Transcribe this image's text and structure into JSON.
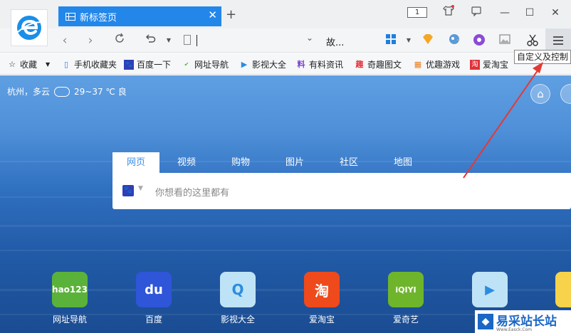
{
  "tab": {
    "title": "新标签页",
    "close": "✕"
  },
  "newtab": "+",
  "window": {
    "badge": "1"
  },
  "address": {
    "search_word": "故..."
  },
  "tooltip": "自定义及控制",
  "bookmarks": [
    {
      "label": "收藏",
      "icon": "☆"
    },
    {
      "label": "手机收藏夹",
      "icon": "📱"
    },
    {
      "label": "百度一下",
      "icon": "du"
    },
    {
      "label": "网址导航",
      "icon": "hao"
    },
    {
      "label": "影视大全",
      "icon": "▶"
    },
    {
      "label": "有料资讯",
      "icon": "料"
    },
    {
      "label": "奇趣图文",
      "icon": "趣"
    },
    {
      "label": "优趣游戏",
      "icon": "▦"
    },
    {
      "label": "爱淘宝",
      "icon": "淘"
    }
  ],
  "weather": {
    "city": "杭州，多云",
    "temp": "29~37 ℃ 良"
  },
  "search": {
    "tabs": [
      "网页",
      "视频",
      "购物",
      "图片",
      "社区",
      "地图"
    ],
    "placeholder": "你想看的这里都有"
  },
  "sites": [
    {
      "label": "网址导航",
      "tile_text": "hao123",
      "color": "#5bb23a"
    },
    {
      "label": "百度",
      "tile_text": "du",
      "color": "#2f55d8"
    },
    {
      "label": "影视大全",
      "tile_text": "Q",
      "color": "#bfe3f6"
    },
    {
      "label": "爱淘宝",
      "tile_text": "淘",
      "color": "#ee4a1b"
    },
    {
      "label": "爱奇艺",
      "tile_text": "iQIYI",
      "color": "#6fb52c"
    },
    {
      "label": "",
      "tile_text": "▶",
      "color": "#bfe3f6"
    }
  ],
  "watermark": {
    "title": "易采站长站",
    "sub": "Www.Easck.Com"
  }
}
